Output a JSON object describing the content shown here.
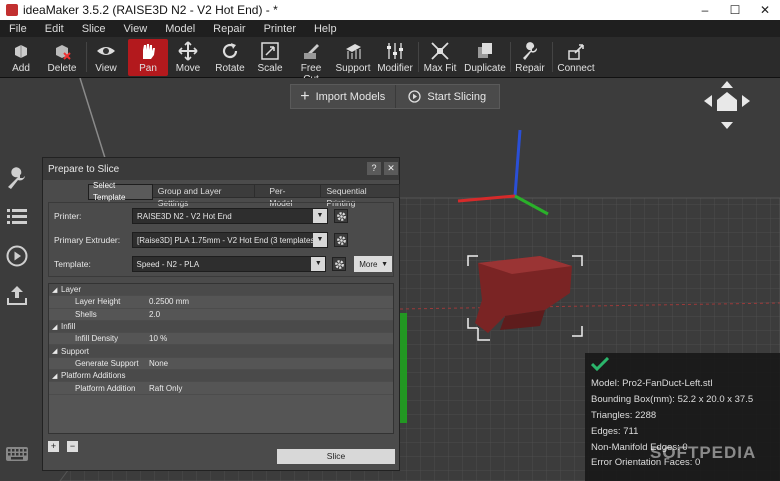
{
  "window": {
    "title": "ideaMaker 3.5.2 (RAISE3D N2 - V2 Hot End) - *"
  },
  "menu": [
    "File",
    "Edit",
    "Slice",
    "View",
    "Model",
    "Repair",
    "Printer",
    "Help"
  ],
  "toolbar": {
    "items": [
      {
        "label": "Add",
        "icon": "add-model-icon"
      },
      {
        "label": "Delete",
        "icon": "delete-model-icon"
      },
      {
        "label": "View",
        "icon": "eye-icon"
      },
      {
        "label": "Pan",
        "icon": "hand-icon",
        "active": true
      },
      {
        "label": "Move",
        "icon": "move-arrows-icon"
      },
      {
        "label": "Rotate",
        "icon": "rotate-icon"
      },
      {
        "label": "Scale",
        "icon": "scale-icon"
      },
      {
        "label": "Free Cut",
        "icon": "free-cut-icon"
      },
      {
        "label": "Support",
        "icon": "support-icon"
      },
      {
        "label": "Modifier",
        "icon": "modifier-icon"
      },
      {
        "label": "Max Fit",
        "icon": "max-fit-icon"
      },
      {
        "label": "Duplicate",
        "icon": "duplicate-icon"
      },
      {
        "label": "Repair",
        "icon": "wrench-icon"
      },
      {
        "label": "Connect",
        "icon": "connect-icon"
      }
    ],
    "active_color": "#b3191d"
  },
  "floatbar": {
    "import_label": "Import Models",
    "slice_label": "Start Slicing"
  },
  "dialog": {
    "title": "Prepare to Slice",
    "tabs": [
      "Select Template",
      "Group and Layer Settings",
      "Per-Model",
      "Sequential Printing"
    ],
    "printer": {
      "label": "Printer:",
      "value": "RAISE3D N2 - V2 Hot End"
    },
    "extruder": {
      "label": "Primary Extruder:",
      "value": "[Raise3D] PLA 1.75mm - V2 Hot End (3 templates)"
    },
    "template": {
      "label": "Template:",
      "value": "Speed - N2 - PLA",
      "more_label": "More"
    },
    "settings": [
      {
        "group": "Layer",
        "rows": [
          {
            "k": "Layer Height",
            "v": "0.2500 mm"
          },
          {
            "k": "Shells",
            "v": "2.0"
          }
        ]
      },
      {
        "group": "Infill",
        "rows": [
          {
            "k": "Infill Density",
            "v": "10 %"
          }
        ]
      },
      {
        "group": "Support",
        "rows": [
          {
            "k": "Generate Support",
            "v": "None"
          }
        ]
      },
      {
        "group": "Platform Additions",
        "rows": [
          {
            "k": "Platform Addition",
            "v": "Raft Only"
          }
        ]
      }
    ],
    "add_label": "+",
    "remove_label": "−",
    "slice_label": "Slice"
  },
  "info": {
    "model": "Model: Pro2-FanDuct-Left.stl",
    "bbox": "Bounding Box(mm): 52.2 x 20.0 x 37.5",
    "triangles": "Triangles: 2288",
    "edges": "Edges: 711",
    "nonmanifold": "Non-Manifold Edges: 0",
    "errors": "Error Orientation Faces: 0"
  },
  "watermark": "SOFTPEDIA"
}
